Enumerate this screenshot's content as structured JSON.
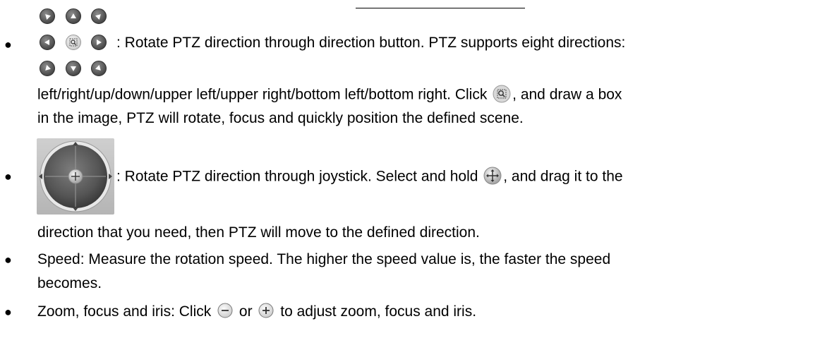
{
  "bullet_char": "●",
  "para1": {
    "line1": ": Rotate PTZ direction through direction button. PTZ supports eight directions:",
    "line2_a": "left/right/up/down/upper left/upper right/bottom left/bottom right. Click ",
    "line2_b": ", and draw a box",
    "line3": "in the image, PTZ will rotate, focus and quickly position the defined scene."
  },
  "para2": {
    "line1_a": ": Rotate PTZ direction through joystick. Select and hold ",
    "line1_b": ", and drag it to the",
    "line2": "direction that you need, then PTZ will move to the defined direction."
  },
  "para3": {
    "line1": "Speed: Measure the rotation speed. The higher the speed value is, the faster the speed",
    "line2": "becomes."
  },
  "para4": {
    "text_a": "Zoom, focus and iris: Click ",
    "text_b": " or ",
    "text_c": " to adjust zoom, focus and iris."
  },
  "icons": {
    "direction_pad": "ptz-direction-pad-icon",
    "zoom_box": "zoom-box-icon",
    "joystick": "ptz-joystick-icon",
    "move_handle": "move-handle-icon",
    "minus": "minus-circle-icon",
    "plus": "plus-circle-icon"
  },
  "colors": {
    "button_dark": "#4a4a4a",
    "button_light": "#d8d8d8",
    "icon_blue": "#3a78b8"
  }
}
